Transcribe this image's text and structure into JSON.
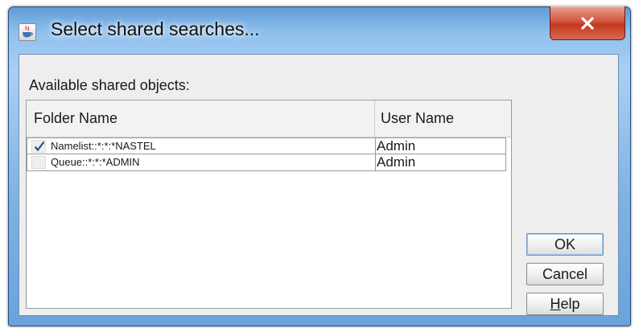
{
  "window": {
    "title": "Select shared searches...",
    "close_symbol": "X"
  },
  "content": {
    "section_label": "Available shared objects:",
    "table": {
      "columns": [
        "Folder Name",
        "User Name"
      ],
      "rows": [
        {
          "checked": true,
          "folder": "Namelist::*:*:*NASTEL",
          "user": "Admin"
        },
        {
          "checked": false,
          "folder": "Queue::*:*:*ADMIN",
          "user": "Admin"
        }
      ]
    }
  },
  "buttons": {
    "ok": "OK",
    "cancel": "Cancel",
    "help_mnemonic": "H",
    "help_rest": "elp"
  },
  "icons": {
    "app": "java-coffee-cup-icon",
    "close": "close-icon",
    "check": "checkmark-icon"
  },
  "colors": {
    "title_bar": "#8fc0ee",
    "close_button": "#c23a1f",
    "dialog_background": "#eeeeee",
    "default_button_border": "#6a90c0"
  }
}
